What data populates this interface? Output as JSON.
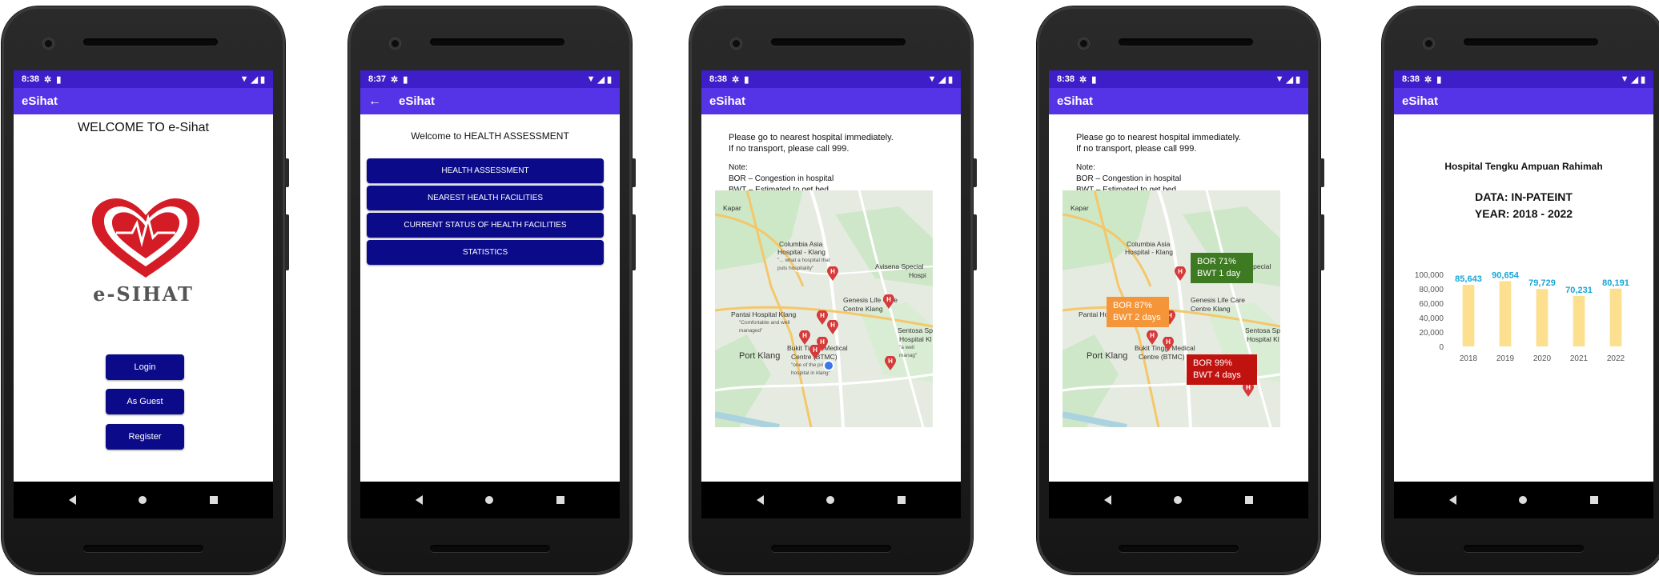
{
  "phones": [
    {
      "time": "8:38",
      "app_title": "eSihat",
      "welcome": "WELCOME TO e-Sihat",
      "logo_text": "e-SIHAT",
      "buttons": {
        "login": "Login",
        "guest": "As Guest",
        "register": "Register"
      }
    },
    {
      "time": "8:37",
      "app_title": "eSihat",
      "heading": "Welcome to HEALTH ASSESSMENT",
      "menu": [
        "HEALTH ASSESSMENT",
        "NEAREST HEALTH FACILITIES",
        "CURRENT STATUS OF HEALTH FACILITIES",
        "STATISTICS"
      ]
    },
    {
      "time": "8:38",
      "app_title": "eSihat",
      "instruction_1": "Please go to nearest hospital immediately.",
      "instruction_2": "If no transport, please call 999.",
      "note_title": "Note:",
      "note_bor": "BOR – Congestion in hospital",
      "note_bwt": "BWT – Estimated to get bed",
      "map_labels": {
        "kapar": "Kapar",
        "columbia": "Columbia Asia",
        "columbia2": "Hospital - Klang",
        "columbia_sub": "\"... what a hospital that puts hospitality\"",
        "avisena": "Avisena Special",
        "avisena2": "Hospi",
        "genesis": "Genesis Life Care",
        "genesis2": "Centre Klang",
        "pantai": "Pantai Hospital Klang",
        "pantai_sub": "\"Comfortable and well managed\"",
        "port_klang": "Port Klang",
        "bukit": "Bukit Tinggi Medical",
        "bukit2": "Centre (BTMC)",
        "bukit_sub": "\"one of the private hospital in klang\"",
        "sentosa": "Sentosa Sp",
        "sentosa2": "Hospital Kl",
        "sentosa_sub": "\"a well manag\""
      }
    },
    {
      "time": "8:38",
      "app_title": "eSihat",
      "instruction_1": "Please go to nearest hospital immediately.",
      "instruction_2": "If no transport, please call 999.",
      "note_title": "Note:",
      "note_bor": "BOR – Congestion in hospital",
      "note_bwt": "BWT – Estimated to get bed",
      "status_boxes": [
        {
          "bor": "BOR 71%",
          "bwt": "BWT 1 day",
          "color": "#3d7a22"
        },
        {
          "bor": "BOR 87%",
          "bwt": "BWT 2 days",
          "color": "#f5953a"
        },
        {
          "bor": "BOR 99%",
          "bwt": "BWT 4 days",
          "color": "#c0120f"
        }
      ]
    },
    {
      "time": "8:38",
      "app_title": "eSihat",
      "hospital": "Hospital  Tengku Ampuan Rahimah",
      "data_line": "DATA: IN-PATEINT",
      "year_line": "YEAR: 2018 - 2022"
    }
  ],
  "chart_data": {
    "type": "bar",
    "categories": [
      "2018",
      "2019",
      "2020",
      "2021",
      "2022"
    ],
    "values": [
      85643,
      90654,
      79729,
      70231,
      80191
    ],
    "value_labels": [
      "85,643",
      "90,654",
      "79,729",
      "70,231",
      "80,191"
    ],
    "ylim": [
      0,
      100000
    ],
    "yticks": [
      "0",
      "20,000",
      "40,000",
      "60,000",
      "80,000",
      "100,000"
    ],
    "bar_color": "#fde08f",
    "label_color": "#1aa5d6"
  },
  "colors": {
    "statusbar": "#3e1ec8",
    "appbar": "#5533e6",
    "navy_button": "#0b0b8a"
  }
}
